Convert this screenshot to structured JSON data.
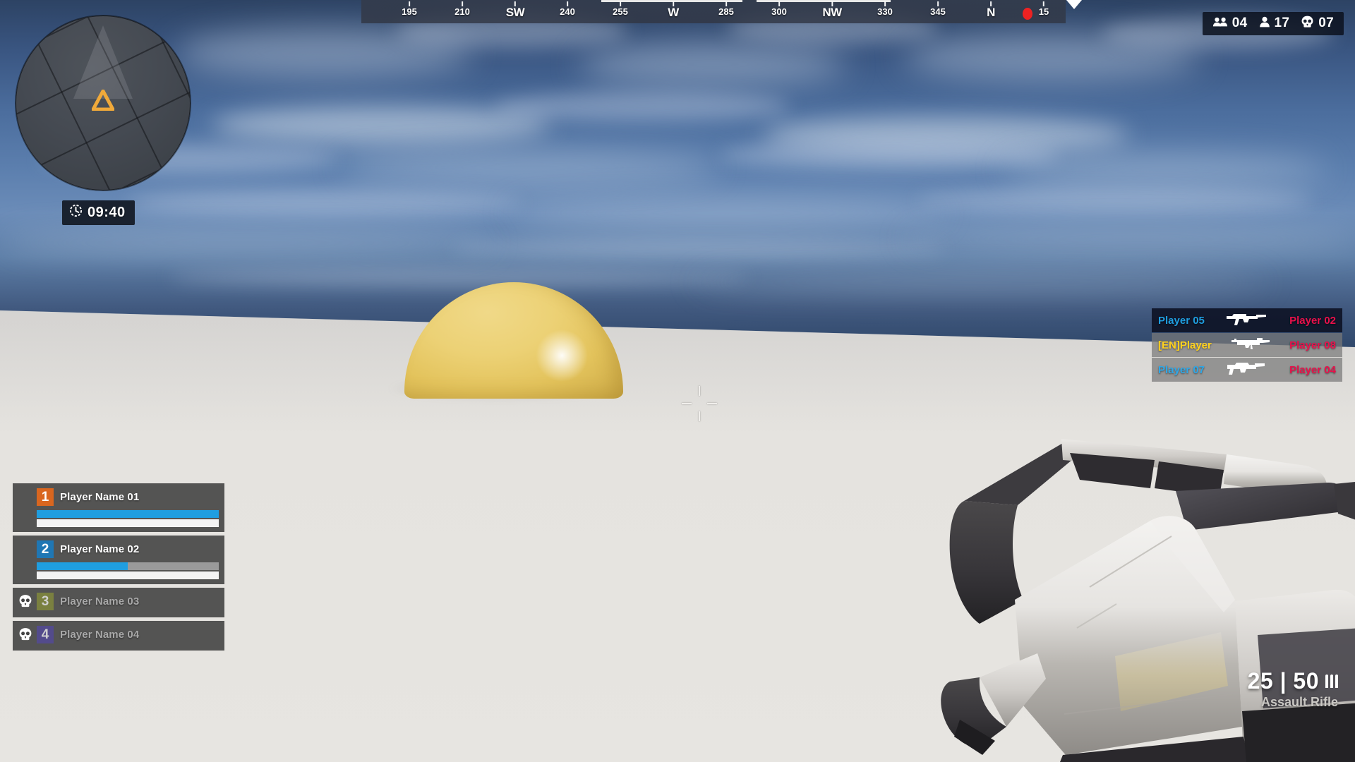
{
  "hud": {
    "minimap": {
      "name": "minimap",
      "player_marker_icon": "player-arrow-icon",
      "view_cone": "view-cone"
    },
    "timer": {
      "icon": "clock-icon",
      "value": "09:40"
    },
    "counters": [
      {
        "icon": "team-group-icon",
        "label": "team-count",
        "value": "04"
      },
      {
        "icon": "person-icon",
        "label": "alive-count",
        "value": "17"
      },
      {
        "icon": "skull-icon",
        "label": "kill-count",
        "value": "07"
      }
    ],
    "compass": {
      "marker_icon": "red-dot-marker",
      "pointer_icon": "compass-pointer-icon",
      "ticks": [
        {
          "label": "195",
          "cardinal": false,
          "pos": 68
        },
        {
          "label": "210",
          "cardinal": false,
          "pos": 143
        },
        {
          "label": "SW",
          "cardinal": true,
          "pos": 218
        },
        {
          "label": "240",
          "cardinal": false,
          "pos": 292
        },
        {
          "label": "255",
          "cardinal": false,
          "pos": 367
        },
        {
          "label": "W",
          "cardinal": true,
          "pos": 442
        },
        {
          "label": "285",
          "cardinal": false,
          "pos": 517
        },
        {
          "label": "300",
          "cardinal": false,
          "pos": 592
        },
        {
          "label": "NW",
          "cardinal": true,
          "pos": 667
        },
        {
          "label": "330",
          "cardinal": false,
          "pos": 742
        },
        {
          "label": "345",
          "cardinal": false,
          "pos": 817
        },
        {
          "label": "N",
          "cardinal": true,
          "pos": 892
        },
        {
          "label": "15",
          "cardinal": false,
          "pos": 967
        }
      ]
    },
    "killfeed": [
      {
        "killer": "Player 05",
        "killer_color": "#1f9ee0",
        "weapon_icon": "assault-rifle-icon",
        "victim": "Player 02",
        "victim_color": "#e8114b",
        "highlight": true
      },
      {
        "killer": "[EN]Player",
        "killer_color": "#ffd21e",
        "weapon_icon": "sniper-rifle-icon",
        "victim": "Player 08",
        "victim_color": "#e8114b",
        "highlight": false
      },
      {
        "killer": "Player 07",
        "killer_color": "#2fa8e8",
        "weapon_icon": "marksman-rifle-icon",
        "victim": "Player 04",
        "victim_color": "#e8114b",
        "highlight": false
      }
    ],
    "team": [
      {
        "slot": "1",
        "name": "Player Name 01",
        "badge_color": "#d9661f",
        "alive": true,
        "health_percent": 100,
        "armor_percent": 100
      },
      {
        "slot": "2",
        "name": "Player Name 02",
        "badge_color": "#1f77b4",
        "alive": true,
        "health_percent": 50,
        "armor_percent": 100
      },
      {
        "slot": "3",
        "name": "Player Name 03",
        "badge_color": "#7a8040",
        "alive": false,
        "status_icon": "skull-icon"
      },
      {
        "slot": "4",
        "name": "Player Name 04",
        "badge_color": "#534b8c",
        "alive": false,
        "status_icon": "skull-icon"
      }
    ],
    "crosshair": {
      "name": "crosshair"
    },
    "ammo": {
      "magazine": "25",
      "separator": "|",
      "reserve": "50",
      "bullets_icon": "bullets-icon",
      "weapon_name": "Assault Rifle"
    }
  },
  "scene": {
    "dome_color": "#ecd175",
    "ground_color": "#e4e2de",
    "sky_top_color": "#2d4364",
    "weapon_model": "first-person-rifle"
  }
}
